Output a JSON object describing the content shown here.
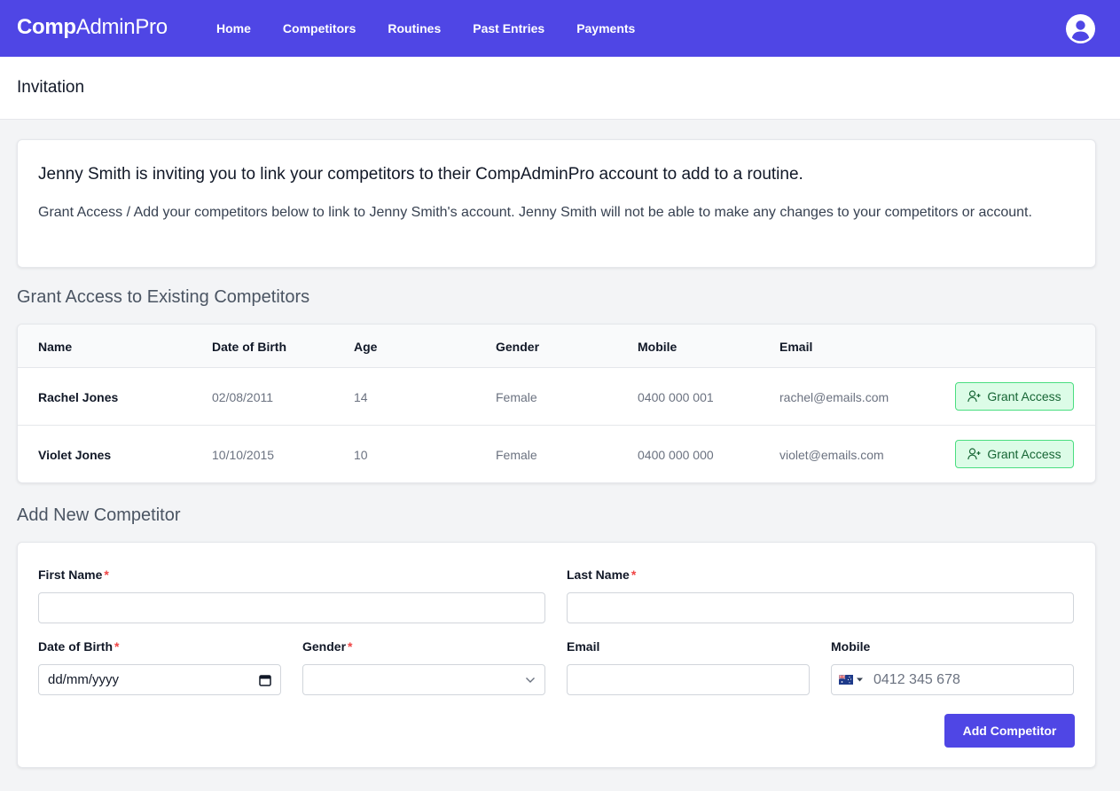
{
  "nav": {
    "brand_bold": "Comp",
    "brand_rest": "AdminPro",
    "links": [
      "Home",
      "Competitors",
      "Routines",
      "Past Entries",
      "Payments"
    ]
  },
  "page_title": "Invitation",
  "invite": {
    "heading": "Jenny Smith is inviting you to link your competitors to their CompAdminPro account to add to a routine.",
    "body": "Grant Access / Add your competitors below to link to Jenny Smith's account. Jenny Smith will not be able to make any changes to your competitors or account."
  },
  "existing": {
    "title": "Grant Access to Existing Competitors",
    "columns": [
      "Name",
      "Date of Birth",
      "Age",
      "Gender",
      "Mobile",
      "Email"
    ],
    "rows": [
      {
        "name": "Rachel Jones",
        "dob": "02/08/2011",
        "age": "14",
        "gender": "Female",
        "mobile": "0400 000 001",
        "email": "rachel@emails.com"
      },
      {
        "name": "Violet Jones",
        "dob": "10/10/2015",
        "age": "10",
        "gender": "Female",
        "mobile": "0400 000 000",
        "email": "violet@emails.com"
      }
    ],
    "grant_label": "Grant Access"
  },
  "new_competitor": {
    "title": "Add New Competitor",
    "first_name_label": "First Name",
    "last_name_label": "Last Name",
    "dob_label": "Date of Birth",
    "dob_placeholder": "dd/mm/yyyy",
    "gender_label": "Gender",
    "email_label": "Email",
    "mobile_label": "Mobile",
    "mobile_placeholder": "0412 345 678",
    "required_marker": "*",
    "submit_label": "Add Competitor"
  },
  "colors": {
    "primary": "#4f46e5",
    "success_bg": "#dcfce7",
    "success_border": "#4ade80",
    "success_text": "#166534",
    "required": "#ef4444"
  },
  "icons": {
    "avatar": "user-circle-icon",
    "grant": "user-plus-icon",
    "calendar": "calendar-icon",
    "chevron": "chevron-down-icon",
    "flag": "australia-flag-icon"
  }
}
